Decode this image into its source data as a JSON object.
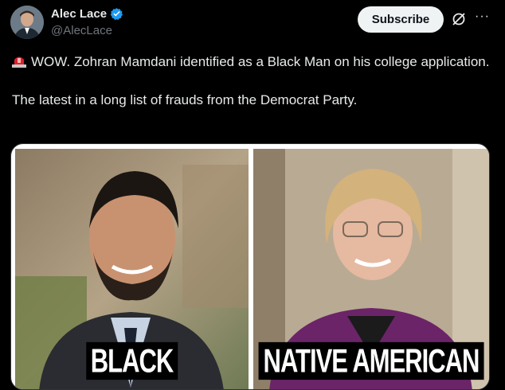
{
  "author": {
    "display_name": "Alec Lace",
    "handle": "@AlecLace",
    "verified": true
  },
  "header": {
    "subscribe_label": "Subscribe",
    "grok_icon": "grok-icon",
    "more_icon": "more-icon",
    "more_glyph": "···"
  },
  "tweet": {
    "emoji": "rotating-light-icon",
    "line1": "WOW. Zohran Mamdani identified as a Black Man on his college application.",
    "line2": "The latest in a long list of frauds from the Democrat Party."
  },
  "media": {
    "left_caption": "BLACK",
    "right_caption": "NATIVE AMERICAN"
  },
  "colors": {
    "background": "#000000",
    "text": "#e7e9ea",
    "secondary": "#71767b",
    "verified_badge": "#1d9bf0",
    "button_bg": "#eff3f4",
    "siren_red": "#e0202a"
  }
}
